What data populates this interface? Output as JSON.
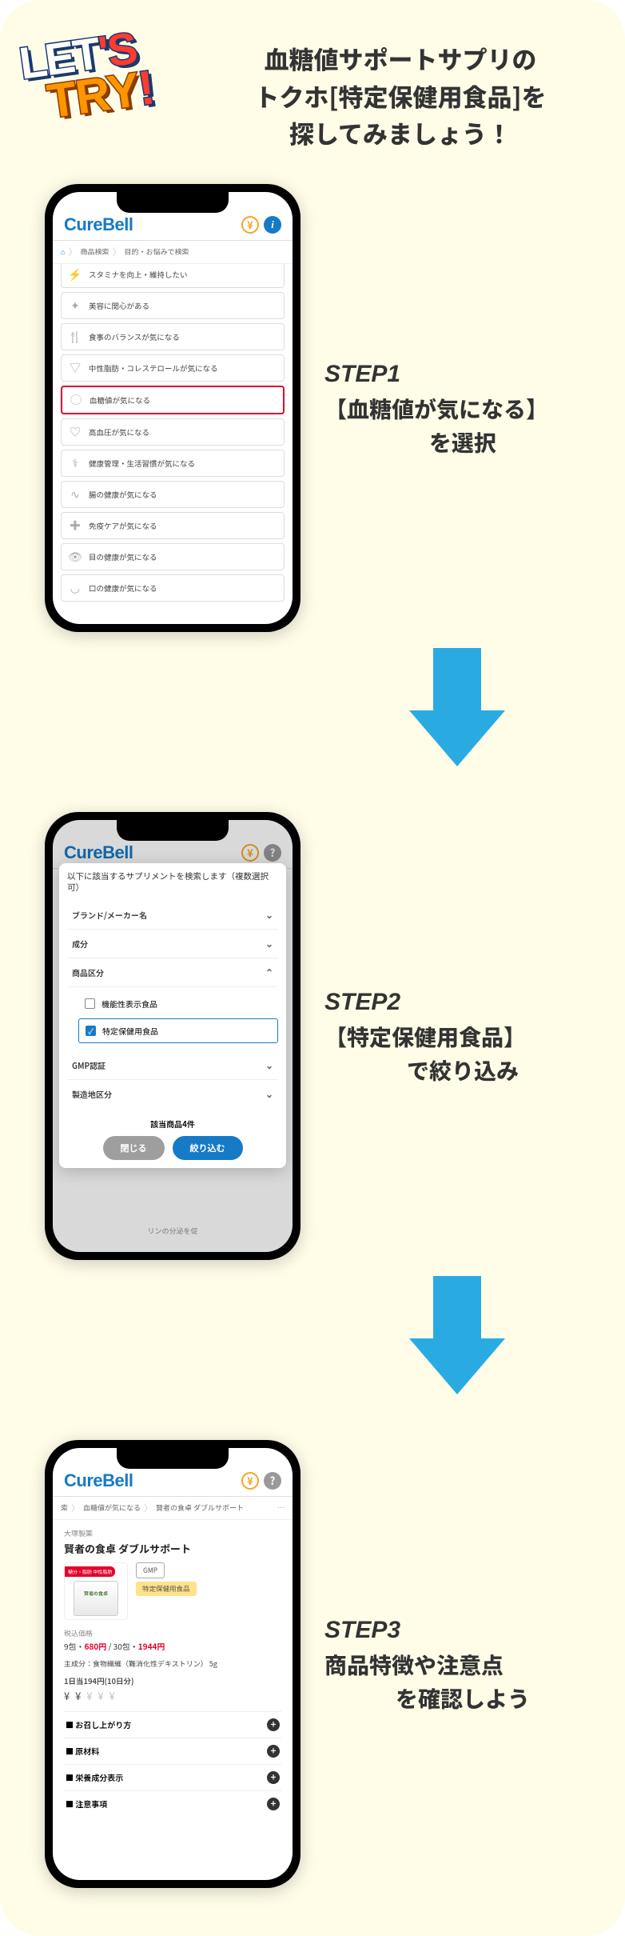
{
  "badge": {
    "line1a": "LET",
    "line1b": "'S",
    "line2a": "TRY",
    "line2b": "!"
  },
  "intro": {
    "l1": "血糖値サポートサプリの",
    "l2": "トクホ[特定保健用食品]を",
    "l3": "探してみましょう！"
  },
  "app": {
    "brand": "CureBell"
  },
  "step1": {
    "title": "STEP1",
    "sub1": "【血糖値が気になる】",
    "sub2": "を選択",
    "crumb1": "商品検索",
    "crumb2": "目的・お悩みで検索",
    "items": [
      "スタミナを向上・維持したい",
      "美容に関心がある",
      "食事のバランスが気になる",
      "中性脂肪・コレステロールが気になる",
      "血糖値が気になる",
      "高血圧が気になる",
      "健康管理・生活習慣が気になる",
      "腸の健康が気になる",
      "免疫ケアが気になる",
      "目の健康が気になる",
      "口の健康が気になる"
    ]
  },
  "step2": {
    "title": "STEP2",
    "sub1": "【特定保健用食品】",
    "sub2": "で絞り込み",
    "modal_head": "以下に該当するサプリメントを検索します（複数選択可）",
    "filters": {
      "brand": "ブランド/メーカー名",
      "ingredient": "成分",
      "category": "商品区分",
      "opt1": "機能性表示食品",
      "opt2": "特定保健用食品",
      "gmp": "GMP認証",
      "region": "製造地区分"
    },
    "result": "該当商品4件",
    "btn_close": "閉じる",
    "btn_apply": "絞り込む",
    "bg_text": "リンの分泌を促"
  },
  "step3": {
    "title": "STEP3",
    "sub1": "商品特徴や注意点",
    "sub2": "を確認しよう",
    "crumb0": "索",
    "crumb1": "血糖値が気になる",
    "crumb2": "賢者の食卓 ダブルサポート",
    "maker": "大塚製薬",
    "name": "賢者の食卓 ダブルサポート",
    "tag_gmp": "GMP",
    "tag_toku": "特定保健用食品",
    "ribbon": "糖分・脂肪 中性脂肪",
    "price_label": "税込価格",
    "price_a1": "9包・",
    "price_a2": "680円",
    "price_sep": " / ",
    "price_b1": "30包・",
    "price_b2": "1944円",
    "ingredient": "主成分：食物繊維（難消化性デキストリン） 5g",
    "daily": "1日当194円(10日分)",
    "acc": [
      "お召し上がり方",
      "原材料",
      "栄養成分表示",
      "注意事項"
    ]
  }
}
